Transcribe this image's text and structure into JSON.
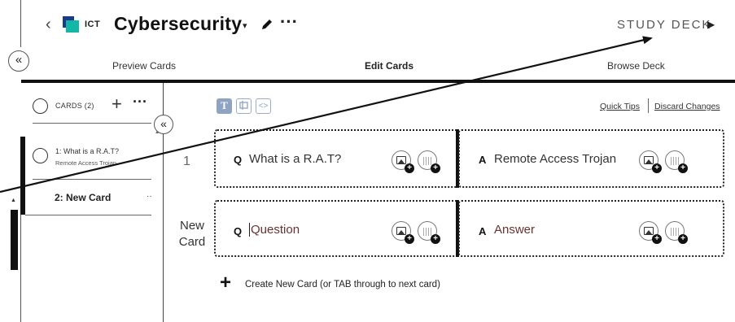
{
  "header": {
    "subject_tag": "ICT",
    "deck_title": "Cybersecurity",
    "caret_glyph": "▾",
    "more_glyph": "···",
    "study_label": "STUDY DECK",
    "study_glyph": "▶"
  },
  "tabs": {
    "preview": "Preview Cards",
    "edit": "Edit Cards",
    "browse": "Browse Deck"
  },
  "sidebar": {
    "count_label": "CARDS (2)",
    "add_glyph": "+",
    "more_glyph": "···",
    "items": [
      {
        "title": "1: What is a R.A.T?",
        "subtitle": "Remote Access Trojan"
      },
      {
        "title": "2: New Card"
      }
    ]
  },
  "collapse_glyph": "«",
  "toolbar": {
    "text_mode": "T",
    "code_mode": "<>",
    "quick_tips": "Quick Tips",
    "discard": "Discard Changes"
  },
  "cards": [
    {
      "row_label": "1",
      "q_letter": "Q",
      "question": "What is a R.A.T?",
      "a_letter": "A",
      "answer": "Remote Access Trojan"
    },
    {
      "row_label_1": "New",
      "row_label_2": "Card",
      "q_letter": "Q",
      "question_placeholder": "Question",
      "a_letter": "A",
      "answer_placeholder": "Answer"
    }
  ],
  "create": {
    "glyph": "+",
    "label": "Create New Card (or TAB through to next card)"
  },
  "colors": {
    "accent_teal": "#12b7a8",
    "accent_navy": "#1b3a8a",
    "toolbar_blue": "#8fa4c2",
    "placeholder": "#6b3030"
  }
}
